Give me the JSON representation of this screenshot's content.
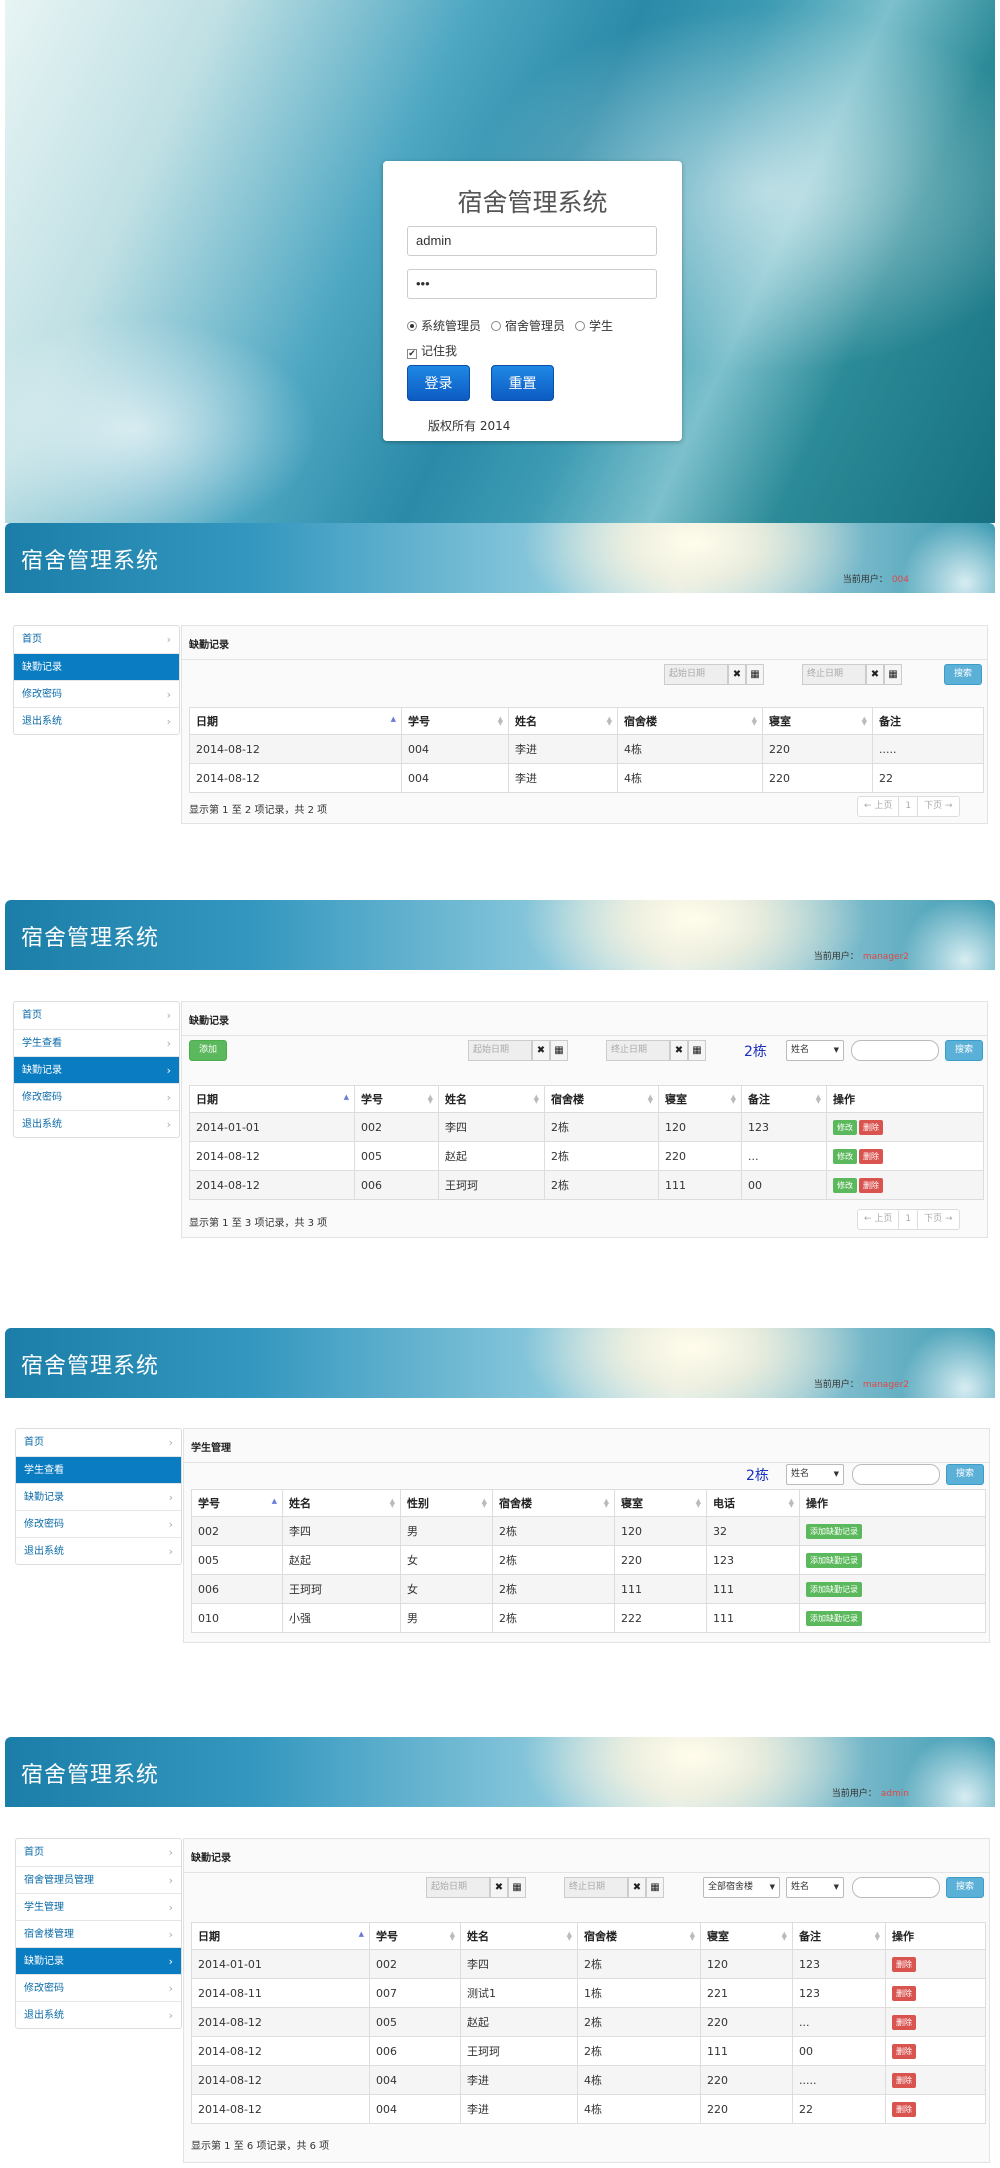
{
  "login": {
    "title": "宿舍管理系统",
    "username_value": "admin",
    "password_value": "•••",
    "roles": [
      "系统管理员",
      "宿舍管理员",
      "学生"
    ],
    "remember_label": "记住我",
    "login_button": "登录",
    "reset_button": "重置",
    "copyright": "版权所有 2014"
  },
  "app_title": "宿舍管理系统",
  "current_user_label": "当前用户：",
  "common": {
    "start_date_placeholder": "起始日期",
    "end_date_placeholder": "终止日期",
    "clear_icon": "✖",
    "calendar_icon": "▦",
    "search_button": "搜索",
    "add_button": "添加",
    "prev_page": "← 上页",
    "page_1": "1",
    "next_page": "下页 →",
    "name_select": "姓名",
    "all_buildings_select": "全部宿舍楼",
    "edit_btn": "修改",
    "delete_btn": "删除",
    "add_absence_btn": "添加缺勤记录"
  },
  "section1": {
    "user": "004",
    "sidebar": [
      "首页",
      "缺勤记录",
      "修改密码",
      "退出系统"
    ],
    "panel_title": "缺勤记录",
    "columns": [
      "日期",
      "学号",
      "姓名",
      "宿舍楼",
      "寝室",
      "备注"
    ],
    "rows": [
      [
        "2014-08-12",
        "004",
        "李进",
        "4栋",
        "220",
        "....."
      ],
      [
        "2014-08-12",
        "004",
        "李进",
        "4栋",
        "220",
        "22"
      ]
    ],
    "info": "显示第 1 至 2 项记录，共 2 项"
  },
  "section2": {
    "user": "manager2",
    "sidebar": [
      "首页",
      "学生查看",
      "缺勤记录",
      "修改密码",
      "退出系统"
    ],
    "panel_title": "缺勤记录",
    "building": "2栋",
    "columns": [
      "日期",
      "学号",
      "姓名",
      "宿舍楼",
      "寝室",
      "备注",
      "操作"
    ],
    "rows": [
      [
        "2014-01-01",
        "002",
        "李四",
        "2栋",
        "120",
        "123"
      ],
      [
        "2014-08-12",
        "005",
        "赵起",
        "2栋",
        "220",
        "..."
      ],
      [
        "2014-08-12",
        "006",
        "王珂珂",
        "2栋",
        "111",
        "00"
      ]
    ],
    "info": "显示第 1 至 3 项记录，共 3 项"
  },
  "section3": {
    "user": "manager2",
    "sidebar": [
      "首页",
      "学生查看",
      "缺勤记录",
      "修改密码",
      "退出系统"
    ],
    "panel_title": "学生管理",
    "building": "2栋",
    "columns": [
      "学号",
      "姓名",
      "性别",
      "宿舍楼",
      "寝室",
      "电话",
      "操作"
    ],
    "rows": [
      [
        "002",
        "李四",
        "男",
        "2栋",
        "120",
        "32"
      ],
      [
        "005",
        "赵起",
        "女",
        "2栋",
        "220",
        "123"
      ],
      [
        "006",
        "王珂珂",
        "女",
        "2栋",
        "111",
        "111"
      ],
      [
        "010",
        "小强",
        "男",
        "2栋",
        "222",
        "111"
      ]
    ]
  },
  "section4": {
    "user": "admin",
    "sidebar": [
      "首页",
      "宿舍管理员管理",
      "学生管理",
      "宿舍楼管理",
      "缺勤记录",
      "修改密码",
      "退出系统"
    ],
    "panel_title": "缺勤记录",
    "columns": [
      "日期",
      "学号",
      "姓名",
      "宿舍楼",
      "寝室",
      "备注",
      "操作"
    ],
    "rows": [
      [
        "2014-01-01",
        "002",
        "李四",
        "2栋",
        "120",
        "123"
      ],
      [
        "2014-08-11",
        "007",
        "测试1",
        "1栋",
        "221",
        "123"
      ],
      [
        "2014-08-12",
        "005",
        "赵起",
        "2栋",
        "220",
        "..."
      ],
      [
        "2014-08-12",
        "006",
        "王珂珂",
        "2栋",
        "111",
        "00"
      ],
      [
        "2014-08-12",
        "004",
        "李进",
        "4栋",
        "220",
        "....."
      ],
      [
        "2014-08-12",
        "004",
        "李进",
        "4栋",
        "220",
        "22"
      ]
    ],
    "info": "显示第 1 至 6 项记录，共 6 项"
  }
}
